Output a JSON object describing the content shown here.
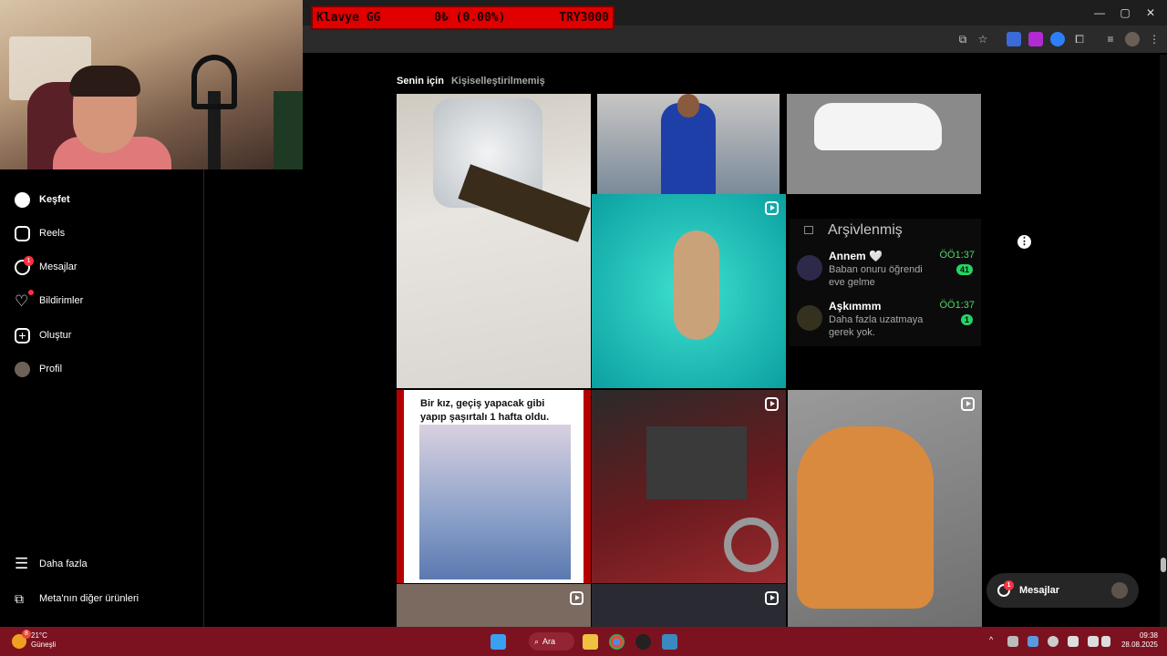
{
  "ticker": {
    "left": "Klavye GG",
    "mid": "0₺ (0.00%)",
    "right": "TRY3000"
  },
  "window": {
    "minimize": "—",
    "maximize": "▢",
    "close": "✕"
  },
  "sidebar": {
    "items": [
      {
        "label": "Keşfet",
        "icon": "compass-icon",
        "active": true
      },
      {
        "label": "Reels",
        "icon": "reels-icon"
      },
      {
        "label": "Mesajlar",
        "icon": "messenger-icon",
        "badge": "1"
      },
      {
        "label": "Bildirimler",
        "icon": "heart-icon"
      },
      {
        "label": "Oluştur",
        "icon": "plus-icon"
      },
      {
        "label": "Profil",
        "icon": "avatar-icon"
      }
    ],
    "more": "Daha fazla",
    "meta": "Meta'nın diğer ürünleri"
  },
  "tabs": {
    "active": "Senin için",
    "inactive": "Kişiselleştirilmemiş"
  },
  "post": {
    "caption_line1": "Bir kız, geçiş yapacak gibi",
    "caption_line2": "yapıp şaşırtalı 1 hafta oldu."
  },
  "archived": {
    "title": "Arşivlenmiş",
    "chats": [
      {
        "name": "Annem 🤍",
        "message": "Baban onuru öğrendi eve gelme",
        "time": "ÖÖ1:37",
        "count": "41"
      },
      {
        "name": "Aşkımmm",
        "message": "Daha fazla uzatmaya gerek yok.",
        "time": "ÖÖ1:37",
        "count": "1"
      }
    ]
  },
  "floating": {
    "label": "Mesajlar",
    "badge": "1"
  },
  "taskbar": {
    "weather_temp": "21°C",
    "weather_text": "Güneşli",
    "weather_badge": "8",
    "search": "Ara",
    "time": "09:38",
    "date": "28.08.2025"
  }
}
